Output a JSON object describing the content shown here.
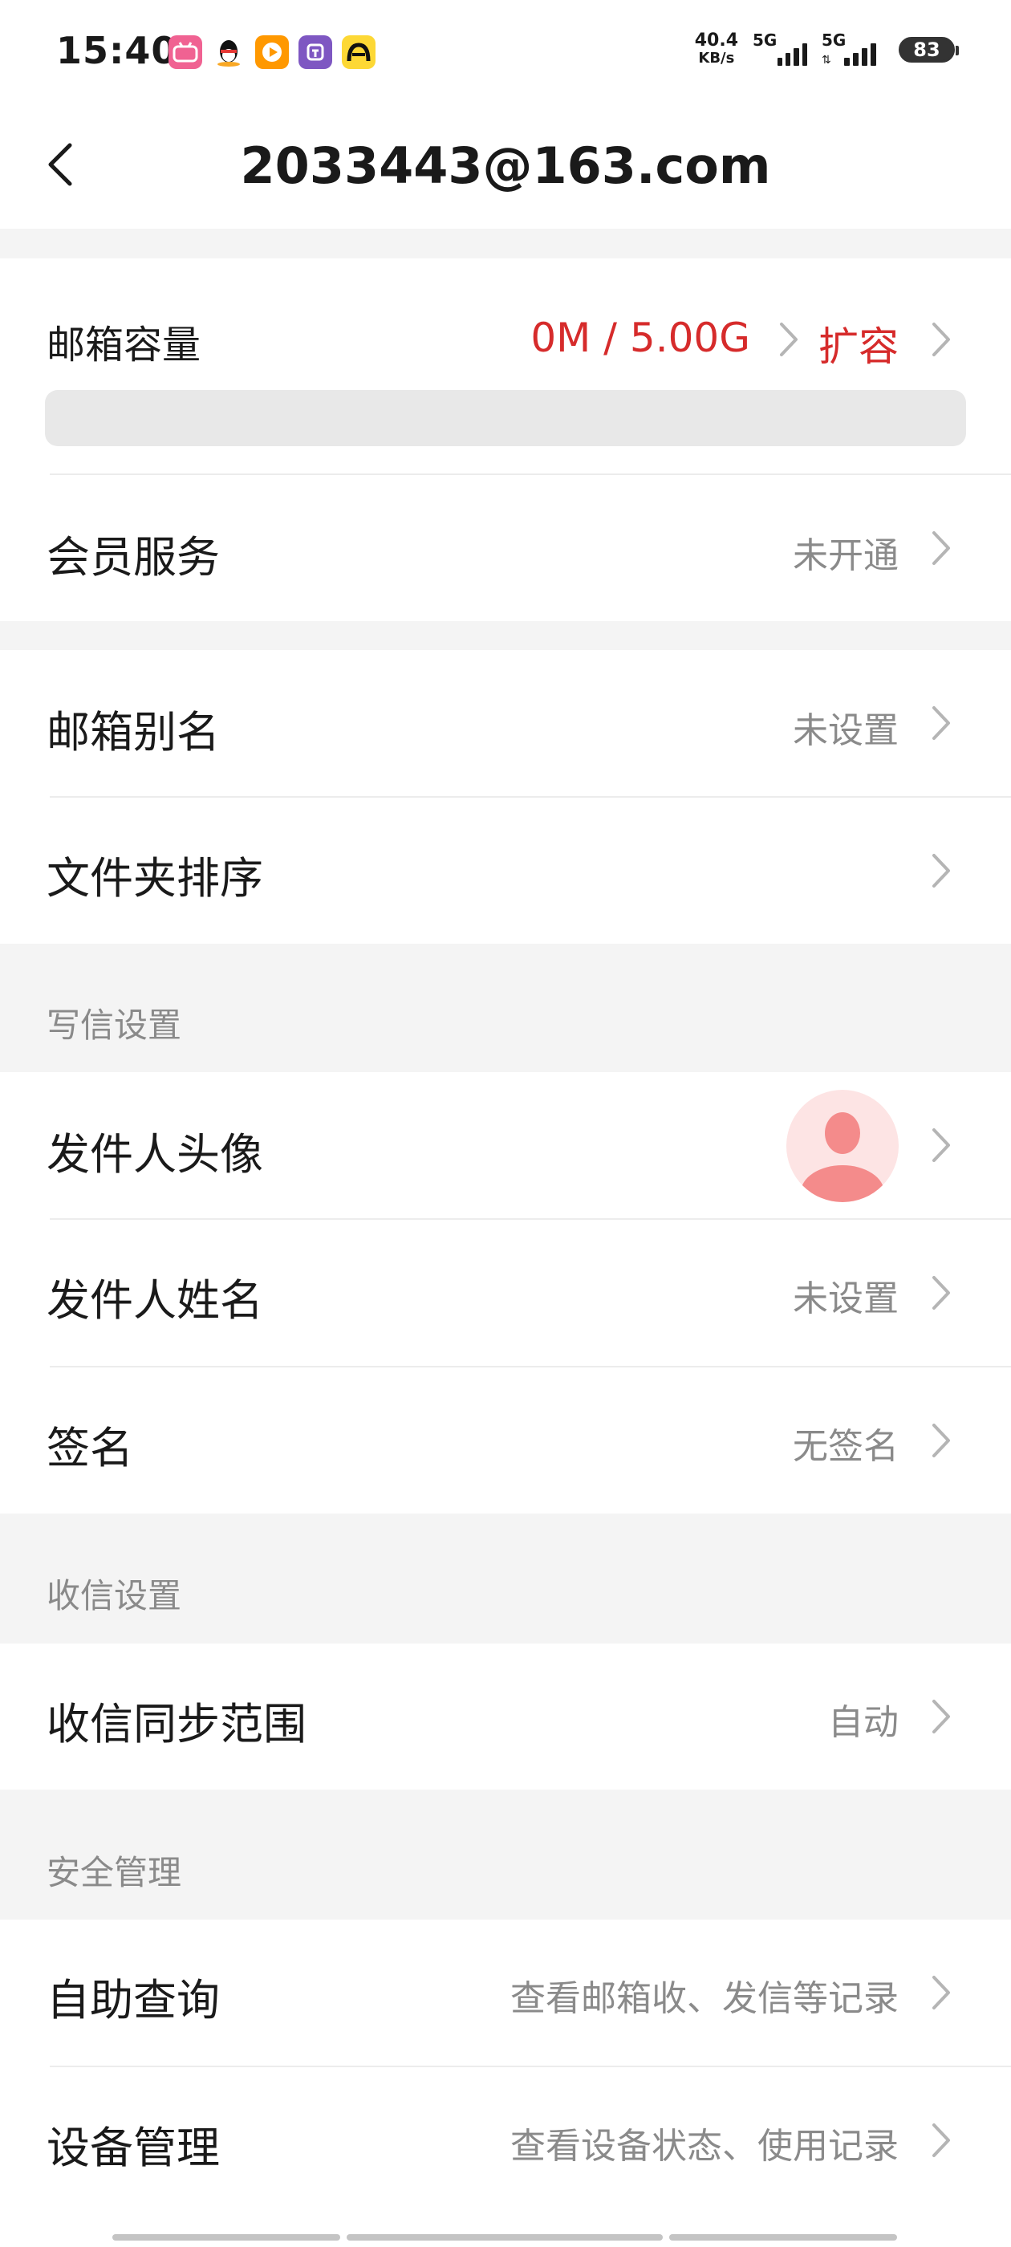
{
  "status_bar": {
    "time": "15:40",
    "net_speed_value": "40.4",
    "net_speed_unit": "KB/s",
    "signal_1_label": "5G",
    "signal_2_label": "5G",
    "battery": "83"
  },
  "header": {
    "title": "2033443@163.com",
    "back_icon": "chevron-left-icon"
  },
  "storage": {
    "label": "邮箱容量",
    "value": "0M / 5.00G",
    "expand_label": "扩容",
    "used_fraction": 0
  },
  "rows": {
    "member": {
      "label": "会员服务",
      "value": "未开通"
    },
    "alias": {
      "label": "邮箱别名",
      "value": "未设置"
    },
    "folder_sort": {
      "label": "文件夹排序",
      "value": ""
    },
    "sender_avatar": {
      "label": "发件人头像"
    },
    "sender_name": {
      "label": "发件人姓名",
      "value": "未设置"
    },
    "signature": {
      "label": "签名",
      "value": "无签名"
    },
    "sync_range": {
      "label": "收信同步范围",
      "value": "自动"
    },
    "self_query": {
      "label": "自助查询",
      "value": "查看邮箱收、发信等记录"
    },
    "device_mgmt": {
      "label": "设备管理",
      "value": "查看设备状态、使用记录"
    }
  },
  "sections": {
    "compose": "写信设置",
    "receive": "收信设置",
    "security": "安全管理"
  },
  "colors": {
    "accent": "#d62b2b",
    "avatar_bg": "#fde4e4",
    "avatar_fg": "#f48b8b"
  }
}
